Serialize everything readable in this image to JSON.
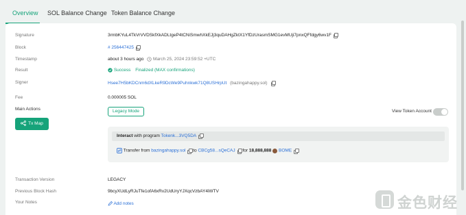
{
  "tabs": [
    "Overview",
    "SOL Balance Change",
    "Token Balance Change"
  ],
  "labels": {
    "signature": "Signature",
    "block": "Block",
    "timestamp": "Timestamp",
    "result": "Result",
    "signer": "Signer",
    "fee": "Fee",
    "main_actions": "Main Actions",
    "tx_version": "Transaction Version",
    "prev_block_hash": "Previous Block Hash",
    "your_notes": "Your Notes"
  },
  "values": {
    "signature": "3rmbKYuL4TkVrVVDSkfXkADLtgeP4tCNiSmwhXkEJj3quDAHgZktX1YfDzUrasmSMG1evMUji7pnxQFfdgy6wv1F",
    "block": "# 256447425",
    "timestamp_relative": "about 3 hours ago",
    "timestamp_absolute": "March 25, 2024 23:59:52 +UTC",
    "result_status": "Success",
    "result_finality": "Finalized (MAX confirmations)",
    "signer_address": "Hsee7H5bKDCnm6dXLkeR9DcWe9Puhnkwk71Q8USHrpUt",
    "signer_name": "(bazingahappy.sol)",
    "fee": "0.000005 SOL",
    "tx_version": "LEGACY",
    "prev_block_hash": "9bcyXUdLyRJuTfe1ofA6xRv2UdUryYJXqcVzbAY4iWTV",
    "add_notes": "Add notes"
  },
  "buttons": {
    "legacy_mode": "Legacy Mode",
    "tx_map": "Tx Map",
    "view_token_account": "View Token Account"
  },
  "action": {
    "interact_bold": "Interact",
    "interact_with": "with program",
    "program": "Tokenk...3VQ5DA",
    "transfer_from": "Transfer from",
    "from": "bazingahappy.sol",
    "to_word": "to",
    "to": "CBCg58...sQeCAJ",
    "for_word": "for",
    "amount": "18,888,888",
    "token": "BOME"
  },
  "watermark": "金色财经",
  "colors": {
    "accent": "#16a37a",
    "link": "#2a6fd6"
  }
}
